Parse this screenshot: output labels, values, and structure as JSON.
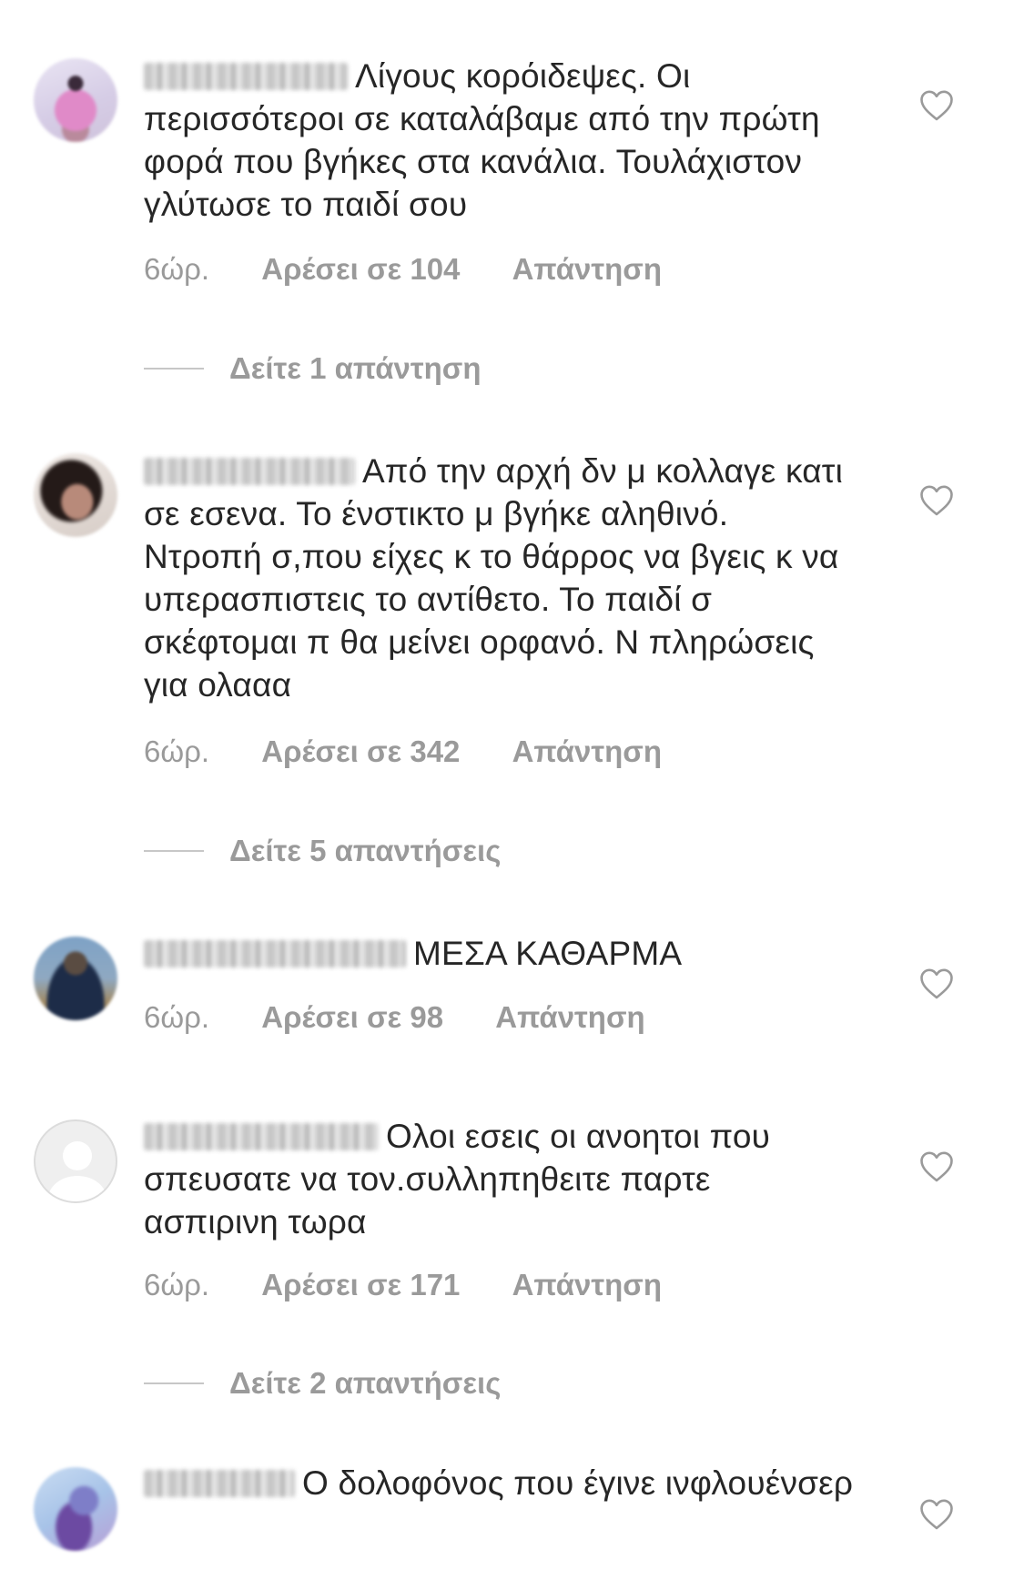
{
  "comments": [
    {
      "text": "Λίγους κορόιδεψες. Οι περισσότεροι σε καταλάβαμε από την πρώτη φορά που βγήκες στα κανάλια. Τουλάχιστον γλύτωσε το παιδί σου",
      "time": "6ώρ.",
      "likes": "Αρέσει σε 104",
      "reply": "Απάντηση",
      "view_replies": "Δείτε 1 απάντηση"
    },
    {
      "text": "Από την αρχή δν μ κολλαγε κατι σε εσενα. Το ένστικτο μ βγήκε αληθινό. Ντροπή σ,που είχες κ το θάρρος να βγεις κ να υπερασπιστεις το αντίθετο. Το παιδί σ σκέφτομαι π θα μείνει ορφανό. Ν πληρώσεις για ολααα",
      "time": "6ώρ.",
      "likes": "Αρέσει σε 342",
      "reply": "Απάντηση",
      "view_replies": "Δείτε 5 απαντήσεις"
    },
    {
      "text": "ΜΕΣΑ ΚΑΘΑΡΜΑ",
      "time": "6ώρ.",
      "likes": "Αρέσει σε 98",
      "reply": "Απάντηση"
    },
    {
      "text": "Ολοι εσεις οι ανοητοι που σπευσατε να τον.συλληπηθειτε παρτε ασπιρινη τωρα",
      "time": "6ώρ.",
      "likes": "Αρέσει σε 171",
      "reply": "Απάντηση",
      "view_replies": "Δείτε 2 απαντήσεις"
    },
    {
      "text": "Ο δολοφόνος που έγινε ινφλουένσερ"
    }
  ],
  "icons": {
    "like": "heart-outline-icon",
    "default_avatar": "default-avatar-icon"
  },
  "colors": {
    "text": "#262626",
    "meta": "#9a9a9a",
    "divider": "#c7c7c7"
  }
}
